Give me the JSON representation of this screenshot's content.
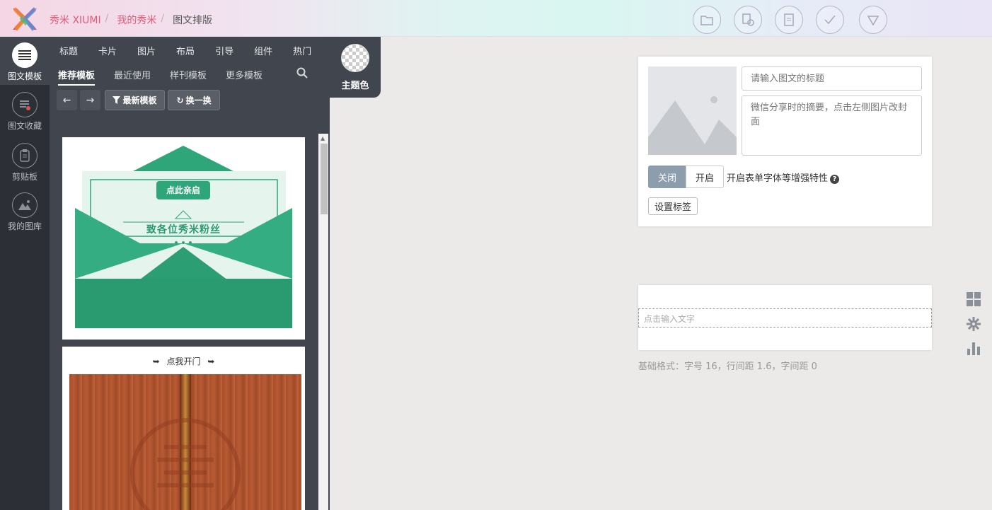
{
  "header": {
    "breadcrumb": [
      {
        "label": "秀米 XIUMI",
        "link": true
      },
      {
        "label": "我的秀米",
        "link": true
      },
      {
        "label": "图文排版",
        "link": false
      }
    ],
    "tools": [
      "folder-icon",
      "save-copy-icon",
      "print-icon",
      "check-icon",
      "dropdown-icon"
    ]
  },
  "rail": {
    "items": [
      {
        "label": "图文模板",
        "icon": "menu-list-icon",
        "active": true
      },
      {
        "label": "图文收藏",
        "icon": "favorite-doc-icon",
        "active": false
      },
      {
        "label": "剪贴板",
        "icon": "clipboard-icon",
        "active": false
      },
      {
        "label": "我的图库",
        "icon": "gallery-icon",
        "active": false
      }
    ]
  },
  "panel": {
    "categories": [
      "标题",
      "卡片",
      "图片",
      "布局",
      "引导",
      "组件",
      "热门"
    ],
    "sub_tabs": [
      "推荐模板",
      "最近使用",
      "样刊模板",
      "更多模板"
    ],
    "active_sub_tab": "推荐模板",
    "filter_label": "最新模板",
    "shuffle_label": "换一换",
    "templates": {
      "envelope_button": "点此亲启",
      "envelope_text": "致各位秀米粉丝",
      "door_caption": "点我开门"
    }
  },
  "theme": {
    "label": "主题色"
  },
  "cover": {
    "title_placeholder": "请输入图文的标题",
    "summary_placeholder": "微信分享时的摘要，点击左侧图片改封面",
    "toggle_off": "关闭",
    "toggle_on": "开启",
    "enhance_text": "开启表单字体等增强特性",
    "tag_button": "设置标签"
  },
  "editor": {
    "placeholder_text": "点击输入文字",
    "base_format": "基础格式：字号 16，行间距 1.6，字间距 0"
  },
  "side_icons": [
    "grid-icon",
    "gear-icon",
    "bar-chart-icon"
  ],
  "colors": {
    "accent": "#e05a77",
    "panel": "#41464e",
    "rail": "#2c3036",
    "toggle_active": "#8c9eae",
    "envelope_green": "#2fa57a"
  }
}
